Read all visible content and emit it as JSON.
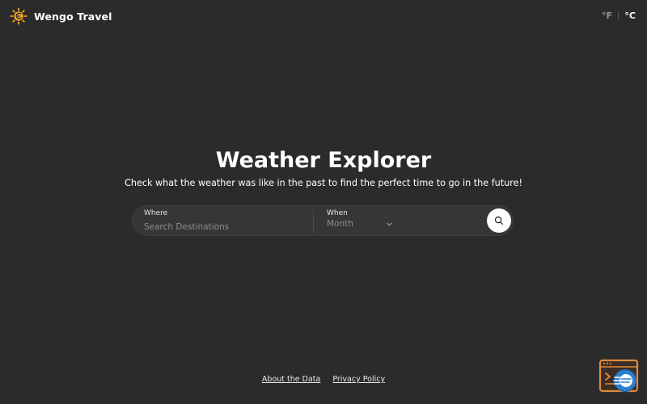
{
  "header": {
    "brand_name": "Wengo Travel",
    "logo_icon": "sun-logo-icon",
    "units": {
      "fahrenheit": "°F",
      "separator": "|",
      "celsius": "°C",
      "selected": "°C"
    }
  },
  "hero": {
    "title": "Weather Explorer",
    "subtitle": "Check what the weather was like in the past to find the perfect time to go in the future!"
  },
  "search": {
    "where_label": "Where",
    "where_placeholder": "Search Destinations",
    "where_value": "",
    "when_label": "When",
    "when_value": "Month",
    "dropdown_icon": "chevron-down-icon",
    "button_icon": "search-icon"
  },
  "footer": {
    "links": [
      {
        "label": "About the Data"
      },
      {
        "label": "Privacy Policy"
      }
    ]
  },
  "corner_widget": {
    "icon": "browser-widget-icon"
  },
  "colors": {
    "background": "#2b2b2b",
    "search_bar": "#363636",
    "logo_orange": "#f5a623",
    "widget_orange": "#e08a3c",
    "widget_blue": "#2d7fd0",
    "text": "#ffffff",
    "muted_text": "#8e8e8e"
  }
}
